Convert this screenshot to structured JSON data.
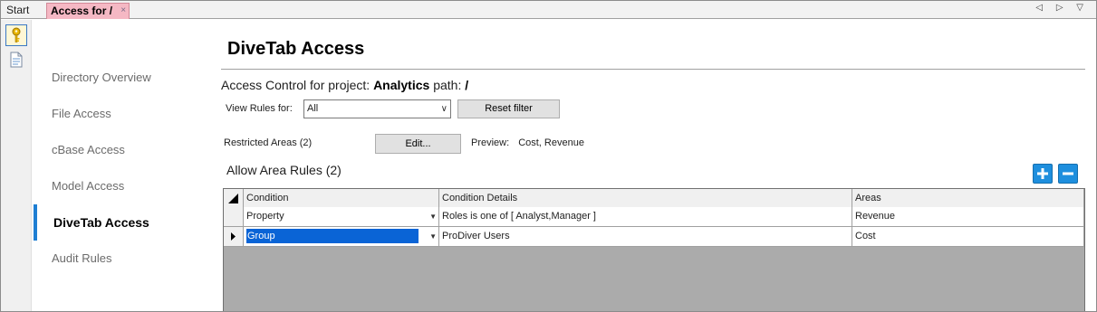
{
  "tabs": {
    "start": "Start",
    "active": "Access for /",
    "close": "×"
  },
  "tab_controls": "◁ ▷ ▽",
  "nav": {
    "items": [
      {
        "label": "Directory Overview"
      },
      {
        "label": "File Access"
      },
      {
        "label": "cBase Access"
      },
      {
        "label": "Model Access"
      },
      {
        "label": "DiveTab Access"
      },
      {
        "label": "Audit Rules"
      }
    ],
    "active": "DiveTab Access"
  },
  "page": {
    "title": "DiveTab Access",
    "access_prefix": "Access Control for project:",
    "project": "Analytics",
    "path_label": "path:",
    "path": "/"
  },
  "filter": {
    "label": "View Rules for:",
    "value": "All",
    "reset_label": "Reset filter"
  },
  "restricted": {
    "label": "Restricted Areas (2)",
    "edit_label": "Edit...",
    "preview_label": "Preview:",
    "preview_value": "Cost, Revenue"
  },
  "rules": {
    "title": "Allow Area Rules (2)",
    "columns": [
      "Condition",
      "Condition Details",
      "Areas"
    ],
    "rows": [
      {
        "condition": "Property",
        "details": "Roles is one of [ Analyst,Manager ]",
        "areas": "Revenue"
      },
      {
        "condition": "Group",
        "details": "ProDiver Users",
        "areas": "Cost"
      }
    ]
  },
  "colors": {
    "accent": "#1e7ed3",
    "active_tab": "#f5b8c4",
    "selection": "#0a64d6",
    "grid_empty": "#ababab",
    "button_blue": "#1e8fde"
  }
}
